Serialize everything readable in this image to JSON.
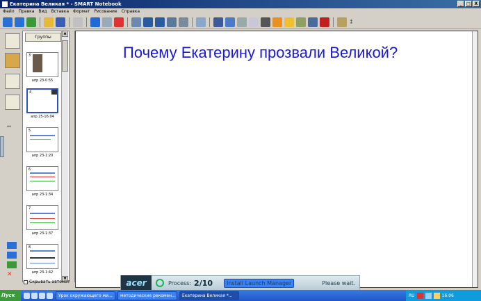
{
  "window": {
    "title": "Екатерина Великая * - SMART Notebook",
    "controls": [
      "_",
      "□",
      "X"
    ]
  },
  "menu": [
    "Файл",
    "Правка",
    "Вид",
    "Вставка",
    "Формат",
    "Рисование",
    "Справка"
  ],
  "sorter": {
    "groups_label": "Группы",
    "thumbnails": [
      {
        "num": "3",
        "label": "апр 23-0:55"
      },
      {
        "num": "4",
        "label": "апр 25-16:04"
      },
      {
        "num": "5",
        "label": "апр 23-1:20"
      },
      {
        "num": "6",
        "label": "апр 23-1:34"
      },
      {
        "num": "7",
        "label": "апр 23-1:37"
      },
      {
        "num": "8",
        "label": "апр 23-1:42"
      }
    ],
    "autohide_label": "Скрывать автомат"
  },
  "slide": {
    "title": "Почему Екатерину прозвали Великой?"
  },
  "acer_popup": {
    "brand": "acer",
    "process_label": "Process:",
    "process_count": "2/10",
    "task": "Install Launch Manager",
    "status": "Please wait."
  },
  "taskbar": {
    "start": "Пуск",
    "tasks": [
      "Урок окружающего ми...",
      "методические рекомен...",
      "Екатерина Великая *..."
    ],
    "lang": "RU",
    "time": "16:06"
  },
  "colors": {
    "title_blue": "#1a1ad6",
    "taskbar": "#1f57c9"
  }
}
